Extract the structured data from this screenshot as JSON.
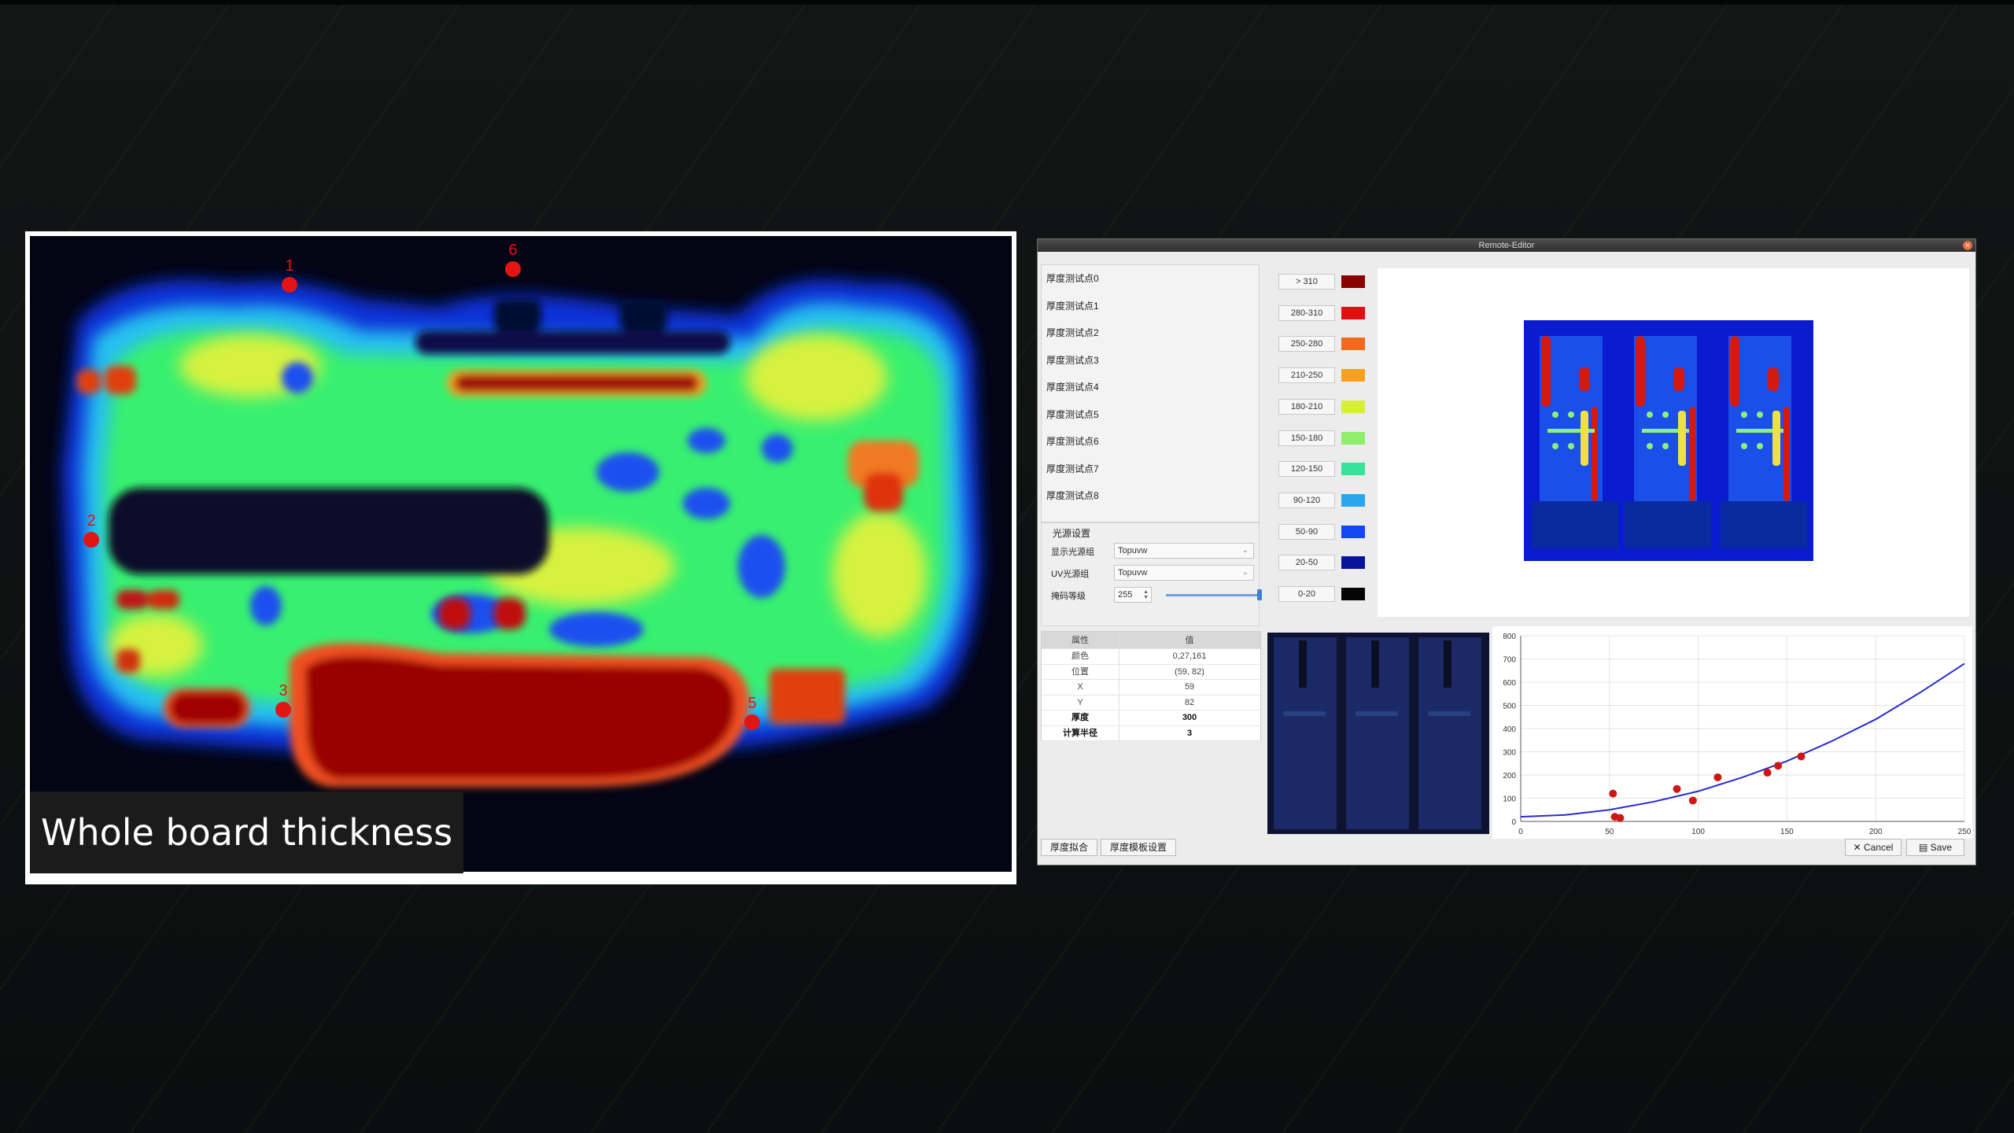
{
  "left_panel": {
    "caption": "Whole board thickness",
    "markers": [
      "1",
      "2",
      "3",
      "5",
      "6"
    ]
  },
  "editor": {
    "title": "Remote-Editor",
    "test_points": [
      "厚度测试点0",
      "厚度测试点1",
      "厚度测试点2",
      "厚度测试点3",
      "厚度测试点4",
      "厚度测试点5",
      "厚度测试点6",
      "厚度测试点7",
      "厚度测试点8"
    ],
    "light_settings": {
      "title": "光源设置",
      "display_source_label": "显示光源组",
      "display_source_value": "Topuvw",
      "uv_source_label": "UV光源组",
      "uv_source_value": "Topuvw",
      "mask_level_label": "掩码等级",
      "mask_level_value": "255",
      "mask_level_fraction": 1.0
    },
    "legend": [
      {
        "label": "> 310",
        "color": "#8b0000"
      },
      {
        "label": "280-310",
        "color": "#e01010"
      },
      {
        "label": "250-280",
        "color": "#f26a1b"
      },
      {
        "label": "210-250",
        "color": "#f7a21f"
      },
      {
        "label": "180-210",
        "color": "#d8ef3a"
      },
      {
        "label": "150-180",
        "color": "#8fef6a"
      },
      {
        "label": "120-150",
        "color": "#35e39a"
      },
      {
        "label": "90-120",
        "color": "#2aa6ef"
      },
      {
        "label": "50-90",
        "color": "#1447f0"
      },
      {
        "label": "20-50",
        "color": "#08149a"
      },
      {
        "label": "0-20",
        "color": "#050505"
      }
    ],
    "properties": {
      "header": [
        "属性",
        "值"
      ],
      "rows": [
        {
          "key": "颜色",
          "value": "0,27,161"
        },
        {
          "key": "位置",
          "value": "(59, 82)"
        },
        {
          "key": "X",
          "value": "59"
        },
        {
          "key": "Y",
          "value": "82"
        },
        {
          "key": "厚度",
          "value": "300"
        },
        {
          "key": "计算半径",
          "value": "3"
        }
      ]
    },
    "buttons": {
      "fit": "厚度拟合",
      "template": "厚度模板设置",
      "cancel": "✕ Cancel",
      "save": "Save"
    }
  },
  "chart_data": {
    "type": "scatter",
    "title": "",
    "xlabel": "",
    "ylabel": "",
    "x_ticks": [
      0,
      50,
      100,
      150,
      200,
      250
    ],
    "y_ticks": [
      0,
      100,
      200,
      300,
      400,
      500,
      600,
      700,
      800
    ],
    "xlim": [
      0,
      250
    ],
    "ylim": [
      0,
      800
    ],
    "grid": true,
    "series": [
      {
        "type": "scatter",
        "color": "#d01515",
        "x": [
          52,
          53,
          56,
          88,
          97,
          111,
          139,
          145,
          158
        ],
        "y": [
          120,
          20,
          15,
          140,
          90,
          190,
          210,
          240,
          280
        ]
      },
      {
        "type": "line",
        "color": "#2a2ad0",
        "x": [
          0,
          25,
          50,
          75,
          100,
          125,
          150,
          175,
          200,
          225,
          250
        ],
        "y": [
          20,
          28,
          50,
          85,
          130,
          190,
          260,
          345,
          440,
          555,
          680
        ]
      }
    ]
  }
}
